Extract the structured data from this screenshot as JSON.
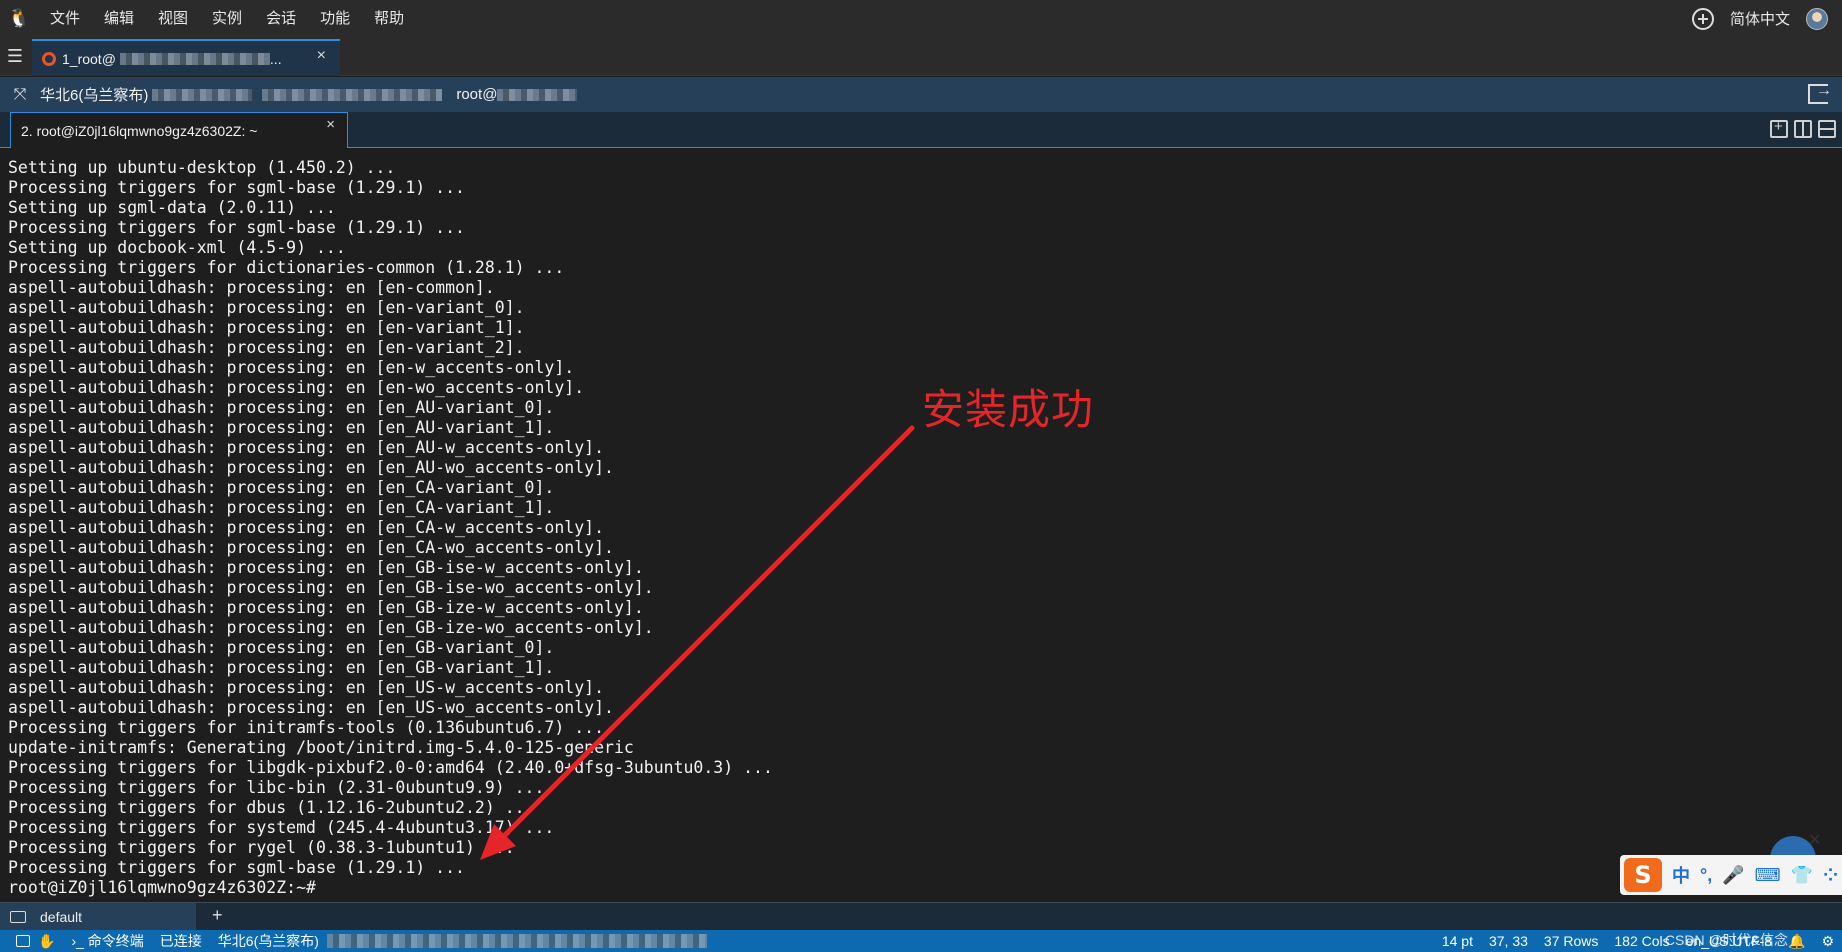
{
  "menubar": {
    "items": [
      "文件",
      "编辑",
      "视图",
      "实例",
      "会话",
      "功能",
      "帮助"
    ],
    "language": "简体中文"
  },
  "session_tab": {
    "label": "1_root@",
    "suffix": "...",
    "close": "×"
  },
  "server_bar": {
    "region": "华北6(乌兰察布)",
    "user": "root@"
  },
  "terminal_tab": {
    "label": "2. root@iZ0jl16lqmwno9gz4z6302Z: ~",
    "close": "×"
  },
  "terminal_lines": [
    "Setting up ubuntu-desktop (1.450.2) ...",
    "Processing triggers for sgml-base (1.29.1) ...",
    "Setting up sgml-data (2.0.11) ...",
    "Processing triggers for sgml-base (1.29.1) ...",
    "Setting up docbook-xml (4.5-9) ...",
    "Processing triggers for dictionaries-common (1.28.1) ...",
    "aspell-autobuildhash: processing: en [en-common].",
    "aspell-autobuildhash: processing: en [en-variant_0].",
    "aspell-autobuildhash: processing: en [en-variant_1].",
    "aspell-autobuildhash: processing: en [en-variant_2].",
    "aspell-autobuildhash: processing: en [en-w_accents-only].",
    "aspell-autobuildhash: processing: en [en-wo_accents-only].",
    "aspell-autobuildhash: processing: en [en_AU-variant_0].",
    "aspell-autobuildhash: processing: en [en_AU-variant_1].",
    "aspell-autobuildhash: processing: en [en_AU-w_accents-only].",
    "aspell-autobuildhash: processing: en [en_AU-wo_accents-only].",
    "aspell-autobuildhash: processing: en [en_CA-variant_0].",
    "aspell-autobuildhash: processing: en [en_CA-variant_1].",
    "aspell-autobuildhash: processing: en [en_CA-w_accents-only].",
    "aspell-autobuildhash: processing: en [en_CA-wo_accents-only].",
    "aspell-autobuildhash: processing: en [en_GB-ise-w_accents-only].",
    "aspell-autobuildhash: processing: en [en_GB-ise-wo_accents-only].",
    "aspell-autobuildhash: processing: en [en_GB-ize-w_accents-only].",
    "aspell-autobuildhash: processing: en [en_GB-ize-wo_accents-only].",
    "aspell-autobuildhash: processing: en [en_GB-variant_0].",
    "aspell-autobuildhash: processing: en [en_GB-variant_1].",
    "aspell-autobuildhash: processing: en [en_US-w_accents-only].",
    "aspell-autobuildhash: processing: en [en_US-wo_accents-only].",
    "Processing triggers for initramfs-tools (0.136ubuntu6.7) ...",
    "update-initramfs: Generating /boot/initrd.img-5.4.0-125-generic",
    "Processing triggers for libgdk-pixbuf2.0-0:amd64 (2.40.0+dfsg-3ubuntu0.3) ...",
    "Processing triggers for libc-bin (2.31-0ubuntu9.9) ...",
    "Processing triggers for dbus (1.12.16-2ubuntu2.2) ...",
    "Processing triggers for systemd (245.4-4ubuntu3.17) ...",
    "Processing triggers for rygel (0.38.3-1ubuntu1) ...",
    "Processing triggers for sgml-base (1.29.1) ...",
    "root@iZ0jl16lqmwno9gz4z6302Z:~#"
  ],
  "annotation": {
    "text": "安装成功",
    "color": "#e5252a"
  },
  "ime": {
    "logo": "S",
    "items": [
      "中",
      "°,",
      "🎤",
      "⌨",
      "👕",
      "⁘"
    ]
  },
  "bottom_tab": {
    "label": "default",
    "add": "+"
  },
  "statusbar": {
    "mode": "命令终端",
    "connection": "已连接",
    "region": "华北6(乌兰察布)",
    "font_size": "14 pt",
    "cursor": "37, 33",
    "rows": "37 Rows",
    "cols": "182 Cols",
    "locale": "en_US.UTF-8",
    "watermark": "CSDN @时代&信念"
  },
  "colors": {
    "accent": "#2f8ee0",
    "statusbar": "#0e6ab0",
    "annotation": "#e5252a"
  }
}
